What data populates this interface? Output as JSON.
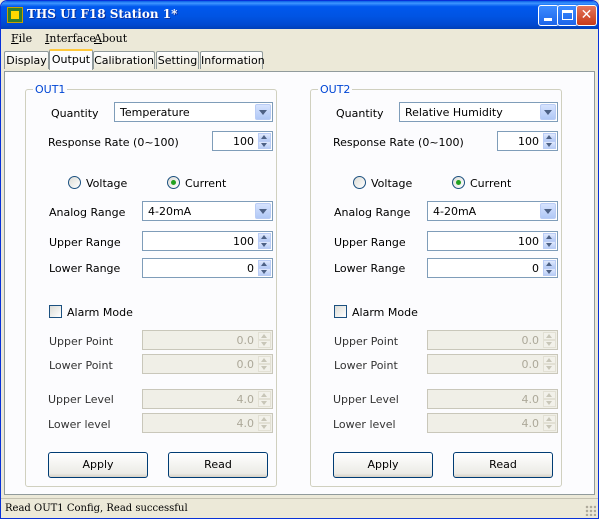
{
  "window": {
    "title": "THS UI F18  Station 1*",
    "minimize_glyph": "minimize-icon",
    "maximize_glyph": "maximize-icon",
    "close_glyph": "✕"
  },
  "menu": {
    "file": "File",
    "file_accel": "F",
    "interface": "Interface",
    "interface_accel": "I",
    "about": "About",
    "about_accel": "A"
  },
  "tabs": [
    {
      "label": "Display",
      "active": false
    },
    {
      "label": "Output",
      "active": true
    },
    {
      "label": "Calibration",
      "active": false
    },
    {
      "label": "Setting",
      "active": false
    },
    {
      "label": "Information",
      "active": false
    }
  ],
  "outputs": [
    {
      "legend": "OUT1",
      "quantity_label": "Quantity",
      "quantity_value": "Temperature",
      "response_rate_label": "Response Rate (0~100)",
      "response_rate_value": "100",
      "voltage_label": "Voltage",
      "current_label": "Current",
      "selected_mode": "Current",
      "analog_range_label": "Analog Range",
      "analog_range_value": "4-20mA",
      "upper_range_label": "Upper Range",
      "upper_range_value": "100",
      "lower_range_label": "Lower Range",
      "lower_range_value": "0",
      "alarm_mode_label": "Alarm Mode",
      "alarm_mode_checked": false,
      "upper_point_label": "Upper Point",
      "upper_point_value": "0.0",
      "lower_point_label": "Lower Point",
      "lower_point_value": "0.0",
      "upper_level_label": "Upper Level",
      "upper_level_value": "4.0",
      "lower_level_label": "Lower level",
      "lower_level_value": "4.0",
      "apply_label": "Apply",
      "read_label": "Read"
    },
    {
      "legend": "OUT2",
      "quantity_label": "Quantity",
      "quantity_value": "Relative Humidity",
      "response_rate_label": "Response Rate (0~100)",
      "response_rate_value": "100",
      "voltage_label": "Voltage",
      "current_label": "Current",
      "selected_mode": "Current",
      "analog_range_label": "Analog Range",
      "analog_range_value": "4-20mA",
      "upper_range_label": "Upper Range",
      "upper_range_value": "100",
      "lower_range_label": "Lower Range",
      "lower_range_value": "0",
      "alarm_mode_label": "Alarm Mode",
      "alarm_mode_checked": false,
      "upper_point_label": "Upper Point",
      "upper_point_value": "0.0",
      "lower_point_label": "Lower Point",
      "lower_point_value": "0.0",
      "upper_level_label": "Upper Level",
      "upper_level_value": "4.0",
      "lower_level_label": "Lower level",
      "lower_level_value": "4.0",
      "apply_label": "Apply",
      "read_label": "Read"
    }
  ],
  "status": {
    "message": "Read OUT1 Config,  Read successful"
  },
  "colors": {
    "titlebar": "#0054e3",
    "group_legend": "#0046d5",
    "active_tab_highlight": "#ffc83c",
    "radio_dot": "#21a121"
  }
}
